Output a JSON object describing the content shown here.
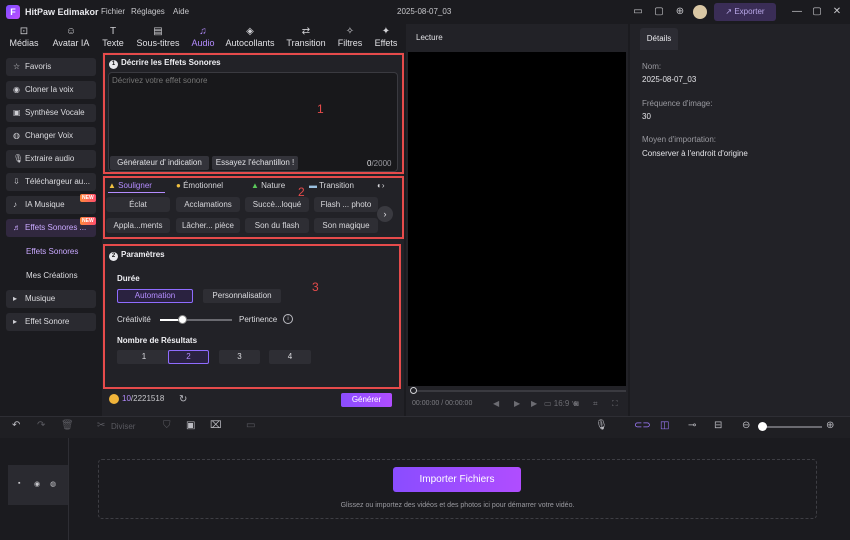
{
  "titlebar": {
    "logo": "F",
    "app_name": "HitPaw Edimakor",
    "menu": [
      "Fichier",
      "Réglages",
      "Aide"
    ],
    "date": "2025-08-07_03",
    "export_label": "Exporter",
    "icons": [
      "screen-icon",
      "message-icon",
      "download-icon",
      "avatar-icon",
      "minimize-icon",
      "maximize-icon",
      "close-icon"
    ]
  },
  "top_tabs": [
    {
      "label": "Médias",
      "icon": "folder-icon"
    },
    {
      "label": "Avatar IA",
      "icon": "avatar-ai-icon"
    },
    {
      "label": "Texte",
      "icon": "text-icon"
    },
    {
      "label": "Sous-titres",
      "icon": "subtitles-icon"
    },
    {
      "label": "Audio",
      "icon": "music-note-icon"
    },
    {
      "label": "Autocollants",
      "icon": "sticker-icon"
    },
    {
      "label": "Transition",
      "icon": "transition-icon"
    },
    {
      "label": "Filtres",
      "icon": "filter-icon"
    },
    {
      "label": "Effets",
      "icon": "effects-icon"
    }
  ],
  "sidebar": {
    "items": [
      {
        "label": "Favoris",
        "icon": "star-icon"
      },
      {
        "label": "Cloner la voix",
        "icon": "clone-voice-icon"
      },
      {
        "label": "Synthèse Vocale",
        "icon": "tts-icon"
      },
      {
        "label": "Changer Voix",
        "icon": "change-voice-icon"
      },
      {
        "label": "Extraire audio",
        "icon": "microphone-icon"
      },
      {
        "label": "Téléchargeur au...",
        "icon": "downloader-icon"
      },
      {
        "label": "IA Musique",
        "icon": "ai-music-icon",
        "badge": "NEW"
      },
      {
        "label": "Effets Sonores ...",
        "icon": "sound-effects-icon",
        "badge": "NEW"
      }
    ],
    "sub_items": [
      "Effets Sonores",
      "Mes Créations"
    ],
    "collapsed": [
      "Musique",
      "Effet Sonore"
    ]
  },
  "describe": {
    "number": "1",
    "title": "Décrire les Effets Sonores",
    "placeholder": "Décrivez votre effet sonore",
    "hint_btn": "Générateur d'  indication",
    "sample_btn": "Essayez l'échantillon !",
    "char_count": "0",
    "char_max": "/2000"
  },
  "annotations": [
    "1",
    "2",
    "3"
  ],
  "categories": {
    "tabs": [
      "Souligner",
      "Émotionnel",
      "Nature",
      "Transition"
    ],
    "chips": [
      "Éclat",
      "Acclamations",
      "Succè...loqué",
      "Flash ... photo",
      "Appla...ments",
      "Lâcher... pièce",
      "Son du flash",
      "Son magique"
    ]
  },
  "params": {
    "number": "2",
    "title": "Paramètres",
    "duration_label": "Durée",
    "duration_options": [
      "Automation",
      "Personnalisation"
    ],
    "creativity_label": "Créativité",
    "relevance_label": "Pertinence",
    "creativity_value": 0.3,
    "results_label": "Nombre de Résultats",
    "results_options": [
      "1",
      "2",
      "3",
      "4"
    ],
    "results_selected": "2"
  },
  "footer": {
    "credits_used": "10",
    "credits_total": "/2221518",
    "generate_label": "Générer"
  },
  "preview": {
    "title": "Lecture",
    "time": "00:00:00 / 00:00:00",
    "aspect": "16:9"
  },
  "details": {
    "tab": "Détails",
    "name_label": "Nom:",
    "name_value": "2025-08-07_03",
    "fps_label": "Fréquence d'image:",
    "fps_value": "30",
    "import_label": "Moyen d'importation:",
    "import_value": "Conserver à l'endroit d'origine"
  },
  "timeline": {
    "divide_label": "Diviser",
    "import_button": "Importer Fichiers",
    "drop_hint": "Glissez ou importez des vidéos et des photos ici pour démarrer votre vidéo."
  },
  "colors": {
    "accent": "#b48cff",
    "annotation_red": "#e64b4b",
    "background": "#1b1b1f",
    "panel": "#222227"
  }
}
